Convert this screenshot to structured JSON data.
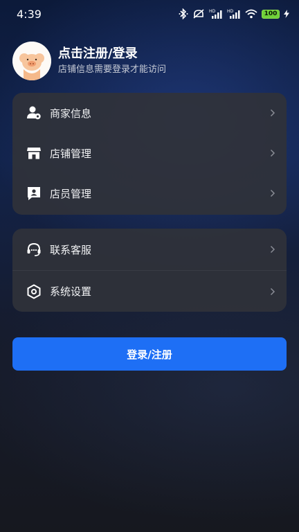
{
  "status_bar": {
    "time": "4:39",
    "battery_level": "100",
    "icons": [
      "bluetooth-icon",
      "mute-icon",
      "hd-signal-icon",
      "hd-signal-icon",
      "wifi-icon",
      "battery-icon",
      "charging-icon"
    ]
  },
  "header": {
    "title": "点击注册/登录",
    "subtitle": "店铺信息需要登录才能访问",
    "avatar_icon": "pig-avatar-icon"
  },
  "menu_group_1": [
    {
      "label": "商家信息",
      "icon": "merchant-user-icon"
    },
    {
      "label": "店铺管理",
      "icon": "store-icon"
    },
    {
      "label": "店员管理",
      "icon": "staff-card-icon"
    }
  ],
  "menu_group_2": [
    {
      "label": "联系客服",
      "icon": "headset-icon"
    },
    {
      "label": "系统设置",
      "icon": "settings-hexagon-icon"
    }
  ],
  "login_button": {
    "label": "登录/注册"
  },
  "colors": {
    "accent": "#1e6ff5",
    "card_bg": "#30323a",
    "battery_green": "#6fd13a"
  }
}
